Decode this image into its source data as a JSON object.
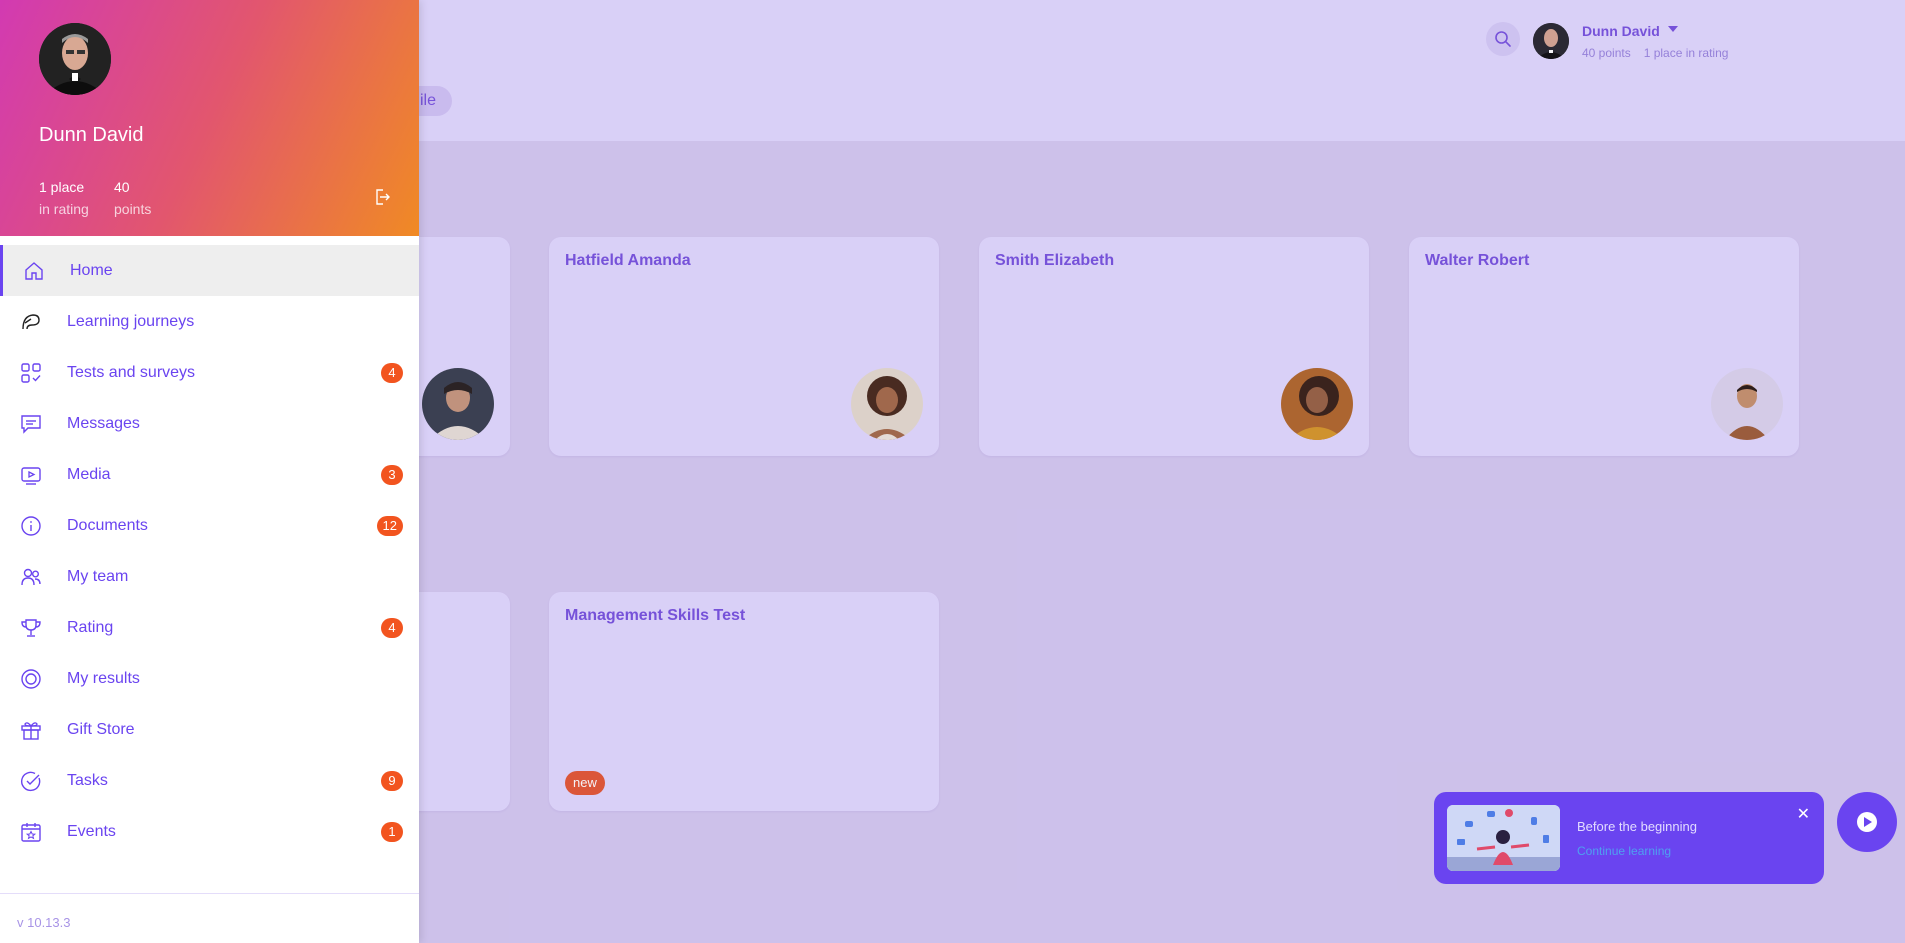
{
  "header": {
    "tab_label": "ile",
    "user": {
      "name": "Dunn David",
      "points": "40 points",
      "rating": "1 place in rating"
    }
  },
  "cards_row1": [
    {
      "name": ""
    },
    {
      "name": "Hatfield Amanda"
    },
    {
      "name": "Smith Elizabeth"
    },
    {
      "name": "Walter Robert"
    }
  ],
  "cards_row2": [
    {
      "name": ""
    },
    {
      "name": "Management Skills Test",
      "badge": "new"
    }
  ],
  "continue_widget": {
    "title": "Before the beginning",
    "link": "Continue learning",
    "close": "✕"
  },
  "drawer": {
    "user_name": "Dunn David",
    "place_value": "1 place",
    "place_label": "in rating",
    "points_value": "40",
    "points_label": "points",
    "items": [
      {
        "label": "Home",
        "icon": "home-icon",
        "badge": ""
      },
      {
        "label": "Learning journeys",
        "icon": "journey-icon",
        "badge": ""
      },
      {
        "label": "Tests and surveys",
        "icon": "tests-icon",
        "badge": "4"
      },
      {
        "label": "Messages",
        "icon": "messages-icon",
        "badge": ""
      },
      {
        "label": "Media",
        "icon": "media-icon",
        "badge": "3"
      },
      {
        "label": "Documents",
        "icon": "documents-icon",
        "badge": "12"
      },
      {
        "label": "My team",
        "icon": "team-icon",
        "badge": ""
      },
      {
        "label": "Rating",
        "icon": "trophy-icon",
        "badge": "4"
      },
      {
        "label": "My results",
        "icon": "results-icon",
        "badge": ""
      },
      {
        "label": "Gift Store",
        "icon": "gift-icon",
        "badge": ""
      },
      {
        "label": "Tasks",
        "icon": "tasks-icon",
        "badge": "9"
      },
      {
        "label": "Events",
        "icon": "events-icon",
        "badge": "1"
      }
    ],
    "version": "v 10.13.3"
  },
  "colors": {
    "accent": "#6a44f0",
    "badge": "#f2541f",
    "header_gradient_start": "#d23ab2",
    "header_gradient_end": "#f08a24"
  }
}
